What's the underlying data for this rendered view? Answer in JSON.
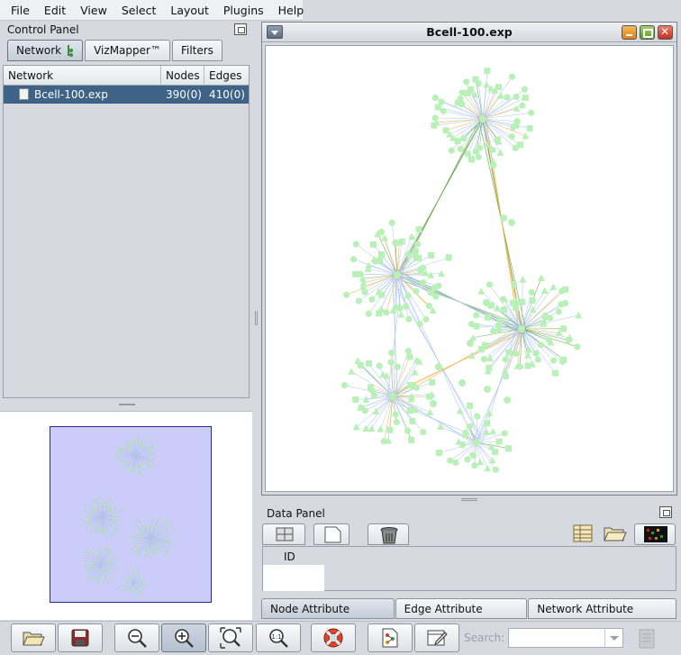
{
  "menu": [
    "File",
    "Edit",
    "View",
    "Select",
    "Layout",
    "Plugins",
    "Help"
  ],
  "control_panel": {
    "title": "Control Panel",
    "tabs": [
      "Network",
      "VizMapper™",
      "Filters"
    ],
    "table": {
      "columns": [
        "Network",
        "Nodes",
        "Edges"
      ],
      "rows": [
        {
          "name": "Bcell-100.exp",
          "nodes": "390(0)",
          "edges": "410(0)"
        }
      ]
    }
  },
  "network_window": {
    "title": "Bcell-100.exp"
  },
  "data_panel": {
    "title": "Data Panel",
    "column": "ID",
    "tabs": [
      "Node Attribute Browser",
      "Edge Attribute Browser",
      "Network Attribute Browser"
    ]
  },
  "toolbar": {
    "search_label": "Search:",
    "search_value": ""
  },
  "colors": {
    "selection": "#3e6386",
    "node": "#b8f0b8",
    "edge_blue": "#a9c4f0",
    "edge_green": "#5a9e3a",
    "edge_orange": "#f0b040",
    "overview_view": "#ccccfb"
  }
}
